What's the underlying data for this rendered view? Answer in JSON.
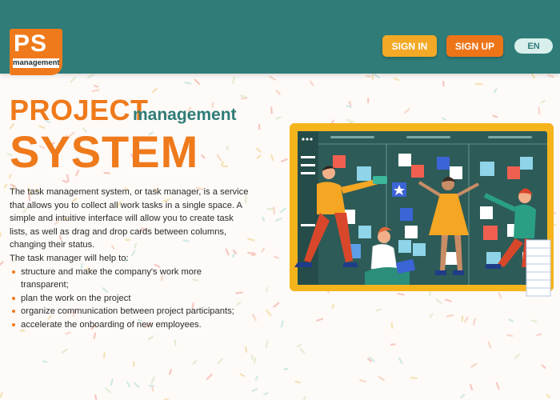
{
  "header": {
    "logo_main": "PS",
    "logo_sub": "management",
    "sign_in": "SIGN IN",
    "sign_up": "SIGN UP",
    "language": "EN"
  },
  "hero": {
    "title_project": "PROJECT",
    "title_management": "management",
    "title_system": "SYSTEM"
  },
  "description": {
    "intro": "The task management system, or task manager, is a service that allows you to collect all work tasks in a single space. A simple and intuitive interface will allow you to create task lists, as well as drag and drop cards between columns, changing their status.",
    "help_heading": "The task manager will help to:",
    "benefits": [
      "structure and make the company's work more transparent;",
      "plan the work on the project",
      "organize communication between project participants;",
      "accelerate the onboarding of new employees."
    ]
  },
  "colors": {
    "header_bg": "#2f7c78",
    "accent_orange": "#ef7a1b",
    "accent_yellow": "#f3a925",
    "lang_bg": "#d8efec"
  },
  "icons": [
    "kanban-board-illustration",
    "people-illustration"
  ]
}
